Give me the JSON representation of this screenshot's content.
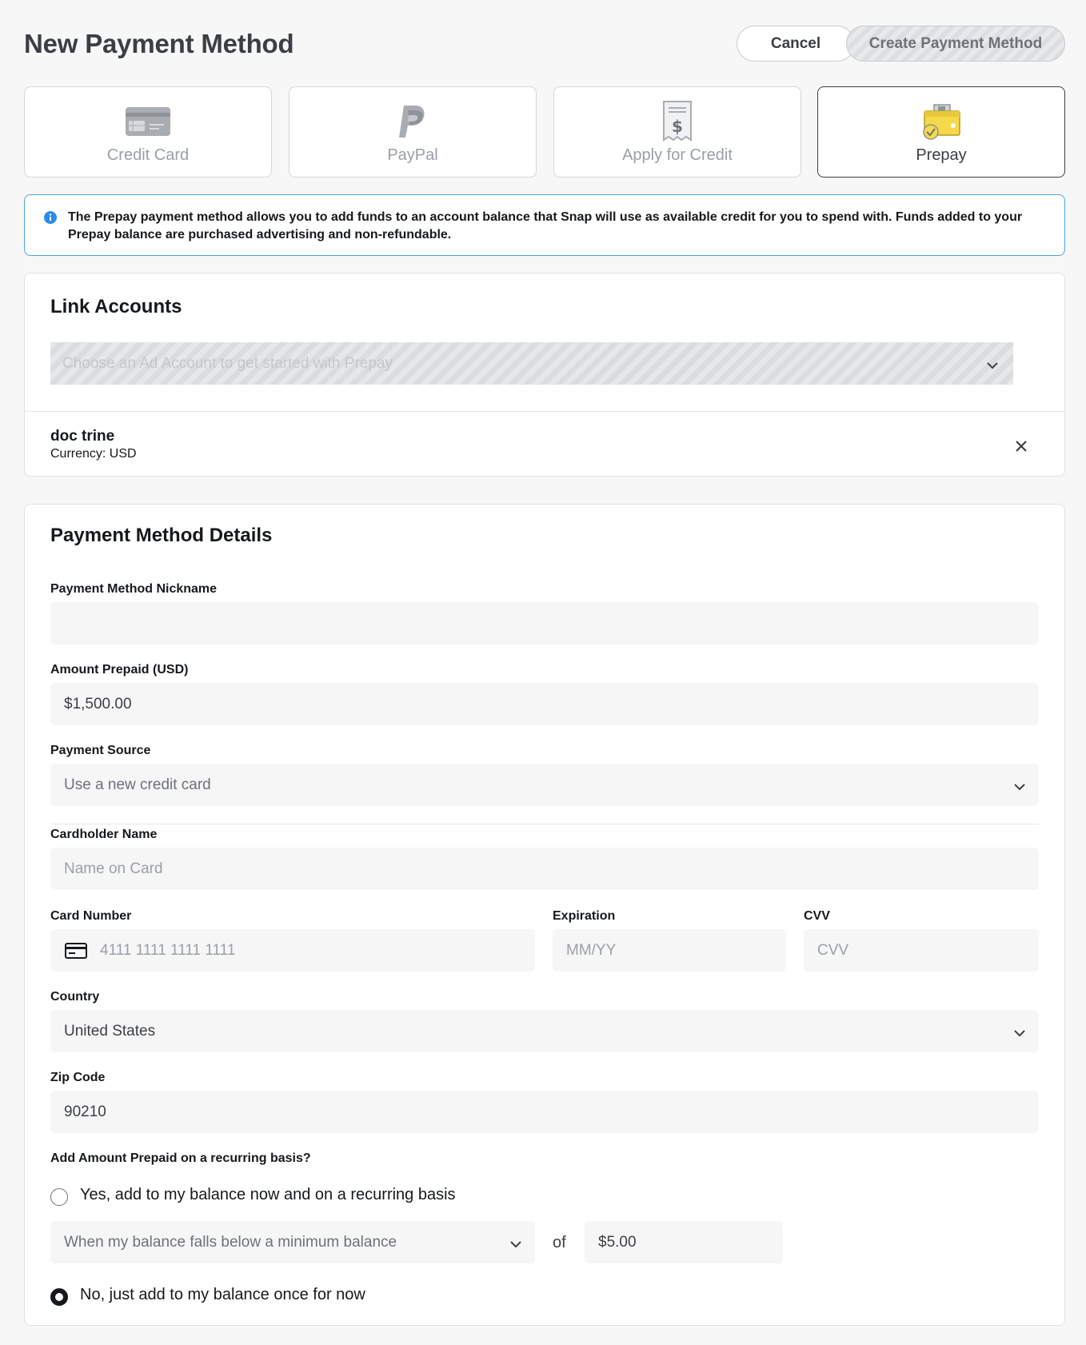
{
  "header": {
    "title": "New Payment Method",
    "cancel_label": "Cancel",
    "create_label": "Create Payment Method"
  },
  "methods": [
    {
      "label": "Credit Card",
      "icon": "credit-card-icon"
    },
    {
      "label": "PayPal",
      "icon": "paypal-icon"
    },
    {
      "label": "Apply for Credit",
      "icon": "invoice-dollar-icon"
    },
    {
      "label": "Prepay",
      "icon": "prepay-wallet-icon",
      "selected": true
    }
  ],
  "info": {
    "text": "The Prepay payment method allows you to add funds to an account balance that Snap will use as available credit for you to spend with. Funds added to your Prepay balance are purchased advertising and non-refundable."
  },
  "link_accounts": {
    "title": "Link Accounts",
    "select_placeholder": "Choose an Ad Account to get started with Prepay",
    "account_name": "doc trine",
    "account_currency": "Currency: USD"
  },
  "details": {
    "title": "Payment Method Details",
    "nickname_label": "Payment Method Nickname",
    "nickname_value": "",
    "amount_label": "Amount Prepaid (USD)",
    "amount_value": "$1,500.00",
    "source_label": "Payment Source",
    "source_value": "Use a new credit card",
    "cardholder_label": "Cardholder Name",
    "cardholder_placeholder": "Name on Card",
    "card_number_label": "Card Number",
    "card_number_placeholder": "4111 1111 1111 1111",
    "expiration_label": "Expiration",
    "expiration_placeholder": "MM/YY",
    "cvv_label": "CVV",
    "cvv_placeholder": "CVV",
    "country_label": "Country",
    "country_value": "United States",
    "zip_label": "Zip Code",
    "zip_value": "90210",
    "recurring_label": "Add Amount Prepaid on a recurring basis?",
    "option_yes": "Yes, add to my balance now and on a recurring basis",
    "recurring_condition": "When my balance falls below a minimum balance",
    "of_text": "of",
    "minimum_value": "$5.00",
    "option_no": "No, just add to my balance once for now"
  },
  "colors": {
    "info_border": "#4aa3e8",
    "prepay_yellow": "#f5d94a",
    "text_dark": "#16191c"
  }
}
